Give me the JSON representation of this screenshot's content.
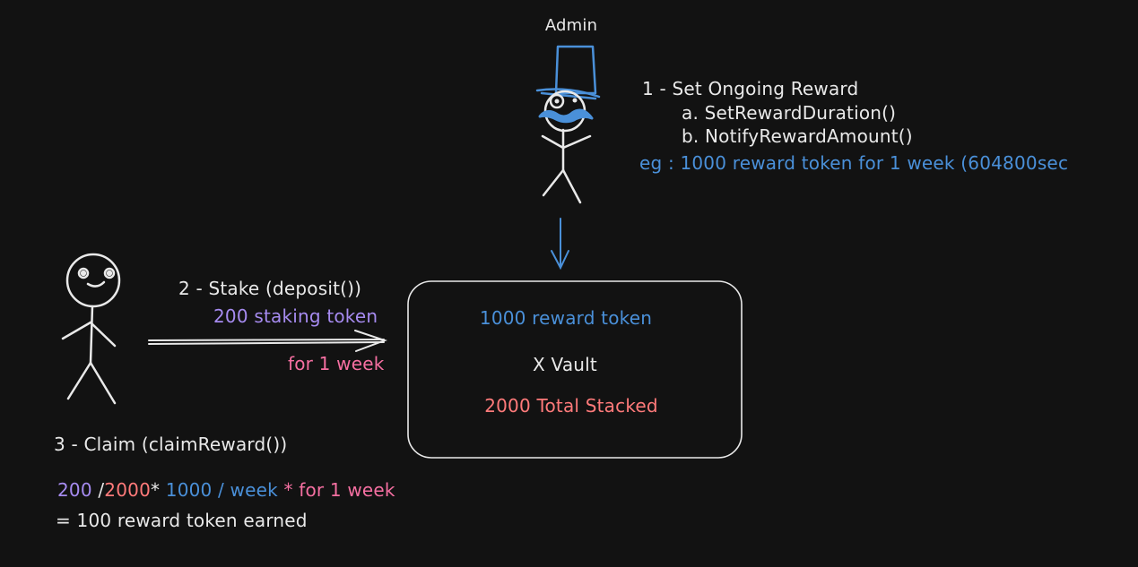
{
  "colors": {
    "background": "#121212",
    "white": "#e9e9e9",
    "blue": "#4a90d9",
    "purple": "#a68bf0",
    "pink": "#f56fa1",
    "red": "#ff7a7a"
  },
  "admin": {
    "label": "Admin",
    "step": "1 - Set Ongoing Reward",
    "substep_a": "a. SetRewardDuration()",
    "substep_b": "b. NotifyRewardAmount()",
    "example": "eg : 1000 reward token for 1 week (604800sec"
  },
  "stake": {
    "step": "2 - Stake (deposit())",
    "amount": "200 staking token",
    "duration": "for 1 week"
  },
  "vault": {
    "reward": "1000 reward token",
    "name": "X Vault",
    "total": "2000 Total Stacked"
  },
  "claim": {
    "step": "3 - Claim (claimReward())",
    "formula": {
      "user_stake": "200",
      "slash": "/",
      "total": "2000",
      "times1": "*",
      "rate": "1000 / week",
      "times2": "*",
      "duration": "for 1 week"
    },
    "result": "= 100 reward token earned"
  },
  "icons": [
    "admin-stick-figure-icon",
    "user-stick-figure-icon",
    "top-hat-icon",
    "monocle-icon",
    "mustache-icon"
  ]
}
